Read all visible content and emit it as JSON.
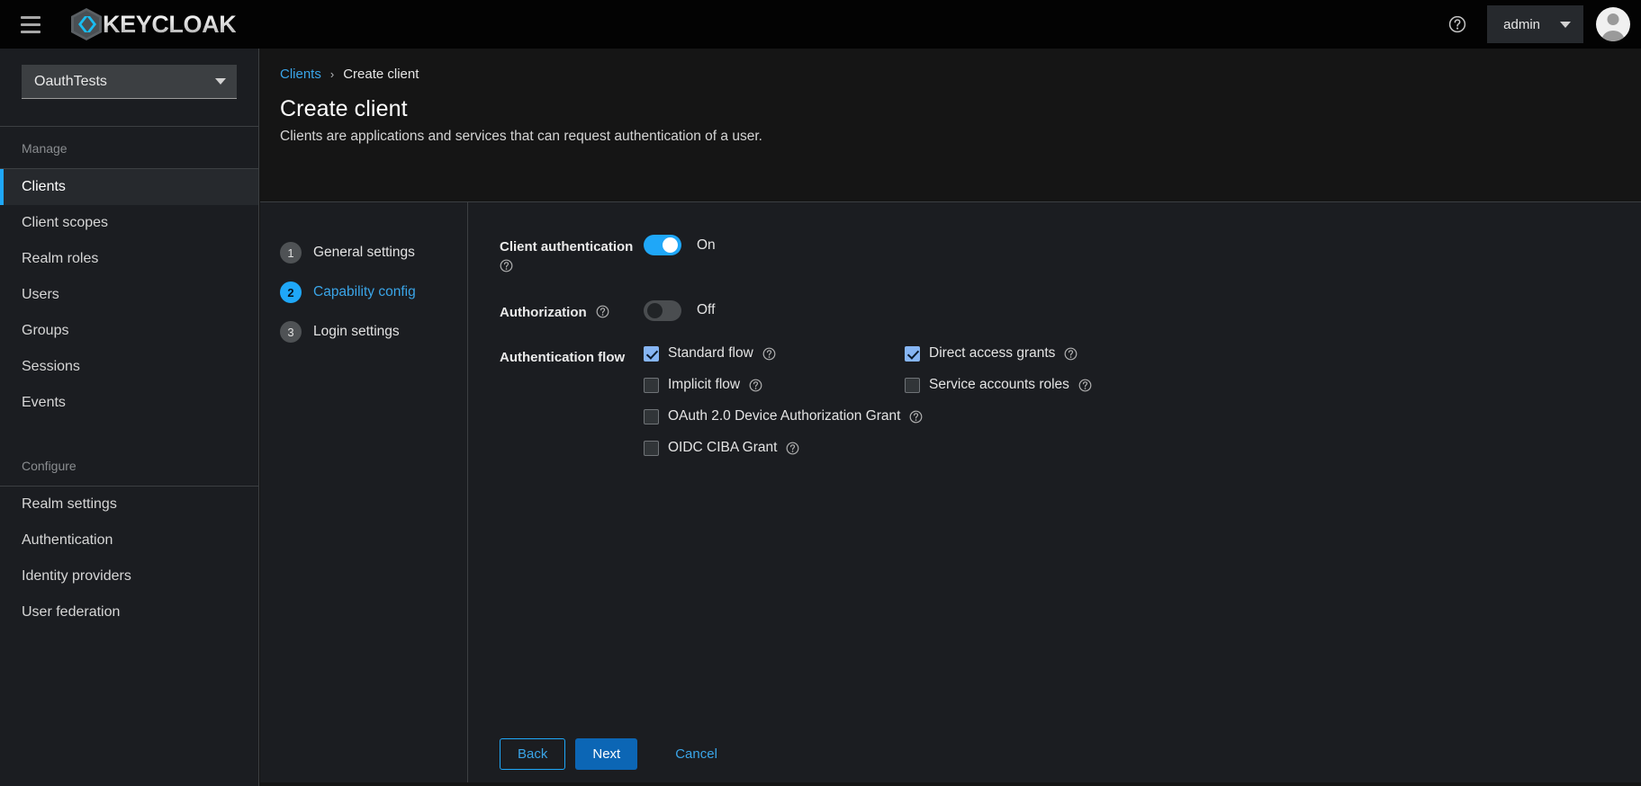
{
  "masthead": {
    "menu_icon": "hamburger-icon",
    "brand_name": "KEYCLOAK",
    "help_icon": "help-circle-icon",
    "username": "admin",
    "avatar_icon": "user-avatar-icon"
  },
  "sidebar": {
    "realm_selector": {
      "value": "OauthTests"
    },
    "sections": [
      {
        "title": "Manage",
        "items": [
          {
            "label": "Clients",
            "active": true
          },
          {
            "label": "Client scopes",
            "active": false
          },
          {
            "label": "Realm roles",
            "active": false
          },
          {
            "label": "Users",
            "active": false
          },
          {
            "label": "Groups",
            "active": false
          },
          {
            "label": "Sessions",
            "active": false
          },
          {
            "label": "Events",
            "active": false
          }
        ]
      },
      {
        "title": "Configure",
        "items": [
          {
            "label": "Realm settings",
            "active": false
          },
          {
            "label": "Authentication",
            "active": false
          },
          {
            "label": "Identity providers",
            "active": false
          },
          {
            "label": "User federation",
            "active": false
          }
        ]
      }
    ]
  },
  "breadcrumb": {
    "parent": "Clients",
    "separator": "›",
    "current": "Create client"
  },
  "page": {
    "title": "Create client",
    "subtitle": "Clients are applications and services that can request authentication of a user."
  },
  "wizard": {
    "steps": [
      {
        "num": "1",
        "label": "General settings",
        "active": false
      },
      {
        "num": "2",
        "label": "Capability config",
        "active": true
      },
      {
        "num": "3",
        "label": "Login settings",
        "active": false
      }
    ]
  },
  "form": {
    "client_authentication": {
      "label": "Client authentication",
      "help_icon": "help-circle-icon",
      "state": "On",
      "on": true
    },
    "authorization": {
      "label": "Authorization",
      "help_icon": "help-circle-icon",
      "state": "Off",
      "on": false
    },
    "authentication_flow": {
      "label": "Authentication flow",
      "options": [
        {
          "label": "Standard flow",
          "checked": true,
          "help_icon": "help-circle-icon"
        },
        {
          "label": "Direct access grants",
          "checked": true,
          "help_icon": "help-circle-icon"
        },
        {
          "label": "Implicit flow",
          "checked": false,
          "help_icon": "help-circle-icon"
        },
        {
          "label": "Service accounts roles",
          "checked": false,
          "help_icon": "help-circle-icon"
        },
        {
          "label": "OAuth 2.0 Device Authorization Grant",
          "checked": false,
          "help_icon": "help-circle-icon"
        },
        {
          "label": "OIDC CIBA Grant",
          "checked": false,
          "help_icon": "help-circle-icon"
        }
      ]
    }
  },
  "footer": {
    "back": "Back",
    "next": "Next",
    "cancel": "Cancel"
  },
  "colors": {
    "accent_blue": "#1fa7f8",
    "link_blue": "#3aa5e8",
    "primary_button": "#0c66b5",
    "checkbox_checked": "#86b5f4",
    "masthead_bg": "#030303",
    "sidebar_bg": "#1b1d21",
    "panel_bg": "#1b1d21",
    "page_bg": "#151515"
  }
}
